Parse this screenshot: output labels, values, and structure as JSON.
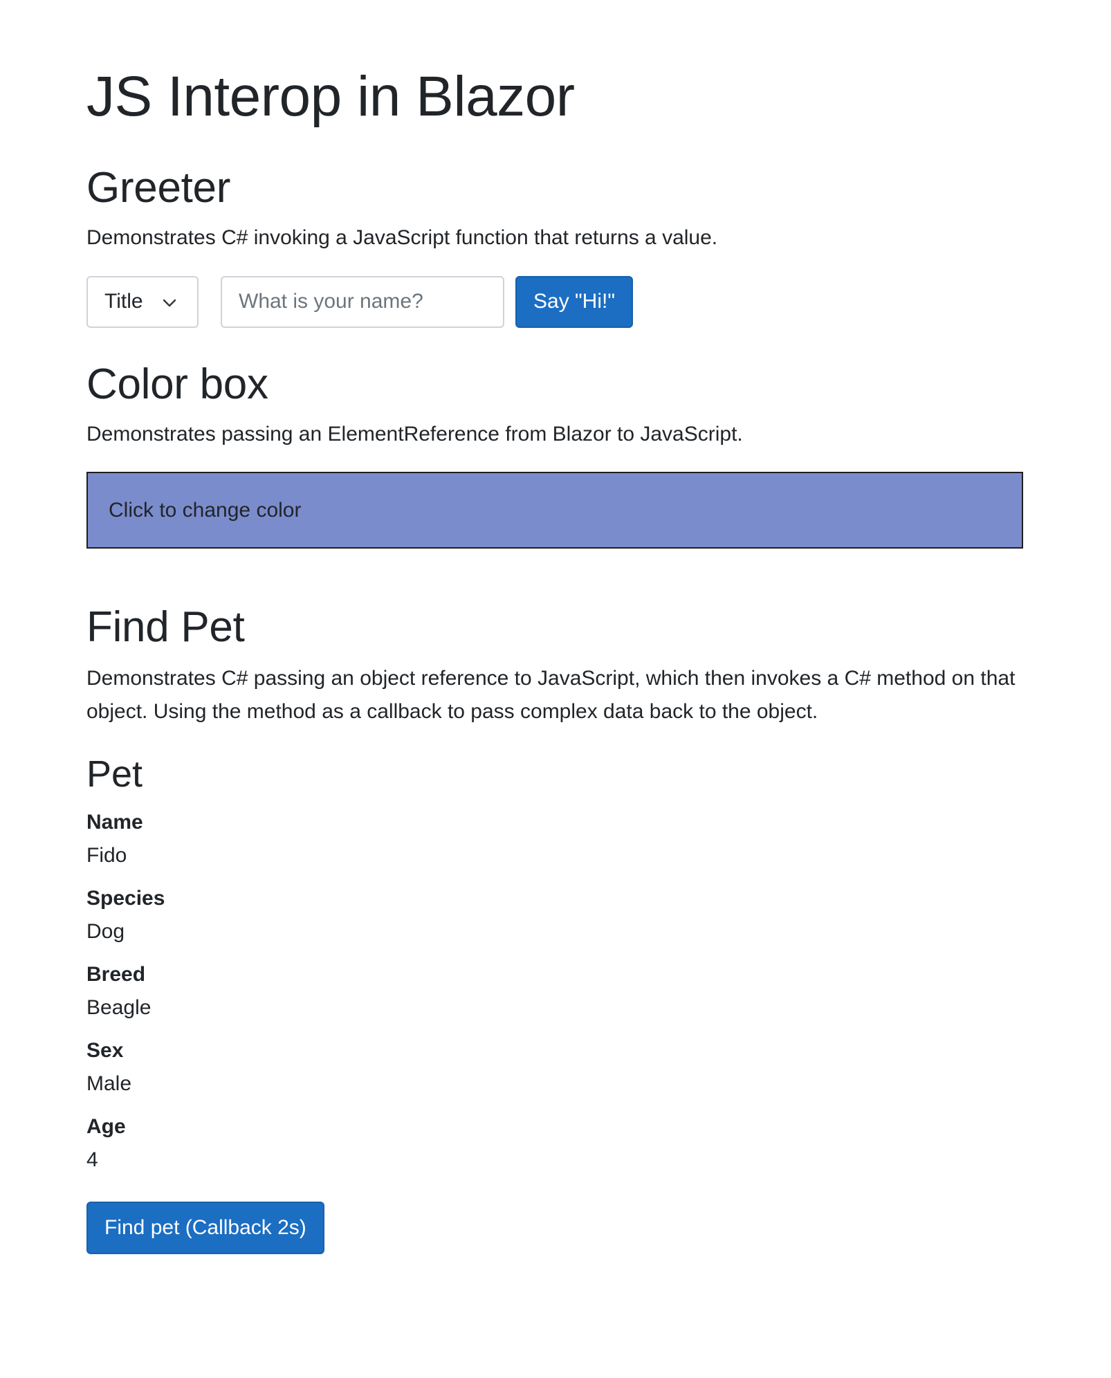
{
  "page": {
    "title": "JS Interop in Blazor"
  },
  "greeter": {
    "heading": "Greeter",
    "description": "Demonstrates C# invoking a JavaScript function that returns a value.",
    "title_select": {
      "selected": "Title"
    },
    "name_input": {
      "value": "",
      "placeholder": "What is your name?"
    },
    "say_hi_label": "Say \"Hi!\""
  },
  "color_box": {
    "heading": "Color box",
    "description": "Demonstrates passing an ElementReference from Blazor to JavaScript.",
    "box_text": "Click to change color",
    "box_color": "#7a8ccc"
  },
  "find_pet": {
    "heading": "Find Pet",
    "description": "Demonstrates C# passing an object reference to JavaScript, which then invokes a C# method on that object. Using the method as a callback to pass complex data back to the object.",
    "pet": {
      "heading": "Pet",
      "fields": [
        {
          "label": "Name",
          "value": "Fido"
        },
        {
          "label": "Species",
          "value": "Dog"
        },
        {
          "label": "Breed",
          "value": "Beagle"
        },
        {
          "label": "Sex",
          "value": "Male"
        },
        {
          "label": "Age",
          "value": "4"
        }
      ]
    },
    "button_label": "Find pet (Callback 2s)"
  },
  "colors": {
    "primary_button": "#1b6ec2",
    "text": "#212529"
  },
  "icons": {
    "select_chevron": "chevron-down-icon"
  }
}
